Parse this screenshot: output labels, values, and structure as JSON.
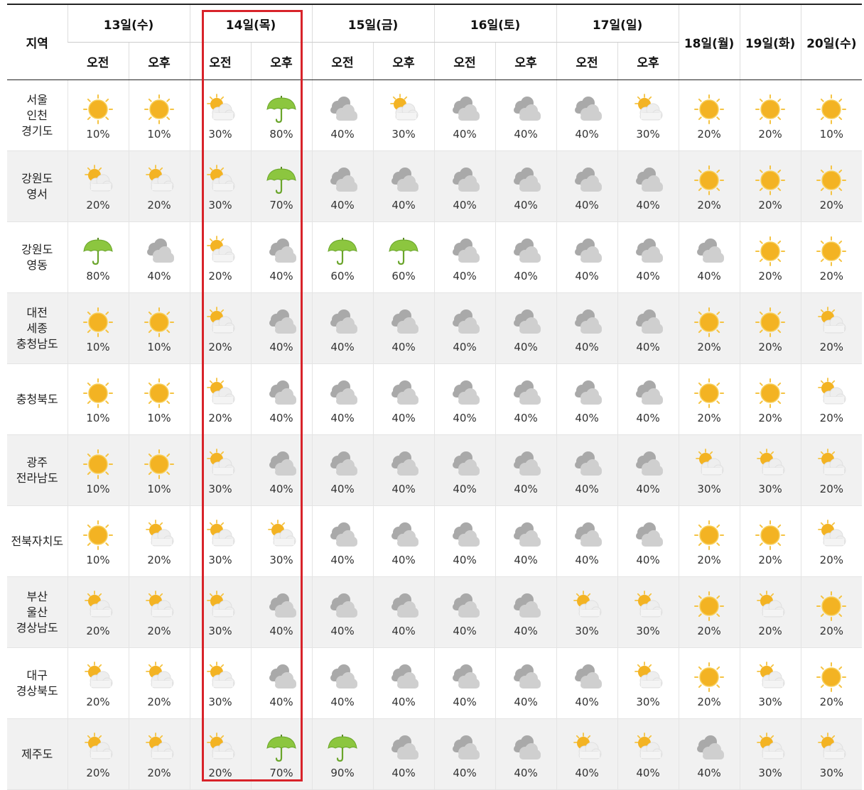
{
  "header": {
    "region_label": "지역",
    "days": [
      {
        "label": "13일(수)",
        "split": true
      },
      {
        "label": "14일(목)",
        "split": true
      },
      {
        "label": "15일(금)",
        "split": true
      },
      {
        "label": "16일(토)",
        "split": true
      },
      {
        "label": "17일(일)",
        "split": true
      },
      {
        "label": "18일(월)",
        "split": false
      },
      {
        "label": "19일(화)",
        "split": false
      },
      {
        "label": "20일(수)",
        "split": false
      }
    ],
    "am_label": "오전",
    "pm_label": "오후"
  },
  "highlight_color": "#d8232a",
  "icons": {
    "sun": "sun-icon",
    "partly": "partly-cloudy-icon",
    "cloud": "cloudy-icon",
    "rain": "umbrella-icon"
  },
  "rows": [
    {
      "region": "서울\n인천\n경기도",
      "cells": [
        {
          "icon": "sun",
          "pct": "10%"
        },
        {
          "icon": "sun",
          "pct": "10%"
        },
        {
          "icon": "partly",
          "pct": "30%"
        },
        {
          "icon": "rain",
          "pct": "80%"
        },
        {
          "icon": "cloud",
          "pct": "40%"
        },
        {
          "icon": "partly",
          "pct": "30%"
        },
        {
          "icon": "cloud",
          "pct": "40%"
        },
        {
          "icon": "cloud",
          "pct": "40%"
        },
        {
          "icon": "cloud",
          "pct": "40%"
        },
        {
          "icon": "partly",
          "pct": "30%"
        },
        {
          "icon": "sun",
          "pct": "20%"
        },
        {
          "icon": "sun",
          "pct": "20%"
        },
        {
          "icon": "sun",
          "pct": "10%"
        }
      ]
    },
    {
      "region": "강원도\n영서",
      "cells": [
        {
          "icon": "partly",
          "pct": "20%"
        },
        {
          "icon": "partly",
          "pct": "20%"
        },
        {
          "icon": "partly",
          "pct": "30%"
        },
        {
          "icon": "rain",
          "pct": "70%"
        },
        {
          "icon": "cloud",
          "pct": "40%"
        },
        {
          "icon": "cloud",
          "pct": "40%"
        },
        {
          "icon": "cloud",
          "pct": "40%"
        },
        {
          "icon": "cloud",
          "pct": "40%"
        },
        {
          "icon": "cloud",
          "pct": "40%"
        },
        {
          "icon": "cloud",
          "pct": "40%"
        },
        {
          "icon": "sun",
          "pct": "20%"
        },
        {
          "icon": "sun",
          "pct": "20%"
        },
        {
          "icon": "sun",
          "pct": "20%"
        }
      ]
    },
    {
      "region": "강원도\n영동",
      "cells": [
        {
          "icon": "rain",
          "pct": "80%"
        },
        {
          "icon": "cloud",
          "pct": "40%"
        },
        {
          "icon": "partly",
          "pct": "20%"
        },
        {
          "icon": "cloud",
          "pct": "40%"
        },
        {
          "icon": "rain",
          "pct": "60%"
        },
        {
          "icon": "rain",
          "pct": "60%"
        },
        {
          "icon": "cloud",
          "pct": "40%"
        },
        {
          "icon": "cloud",
          "pct": "40%"
        },
        {
          "icon": "cloud",
          "pct": "40%"
        },
        {
          "icon": "cloud",
          "pct": "40%"
        },
        {
          "icon": "cloud",
          "pct": "40%"
        },
        {
          "icon": "sun",
          "pct": "20%"
        },
        {
          "icon": "sun",
          "pct": "20%"
        }
      ]
    },
    {
      "region": "대전\n세종\n충청남도",
      "cells": [
        {
          "icon": "sun",
          "pct": "10%"
        },
        {
          "icon": "sun",
          "pct": "10%"
        },
        {
          "icon": "partly",
          "pct": "20%"
        },
        {
          "icon": "cloud",
          "pct": "40%"
        },
        {
          "icon": "cloud",
          "pct": "40%"
        },
        {
          "icon": "cloud",
          "pct": "40%"
        },
        {
          "icon": "cloud",
          "pct": "40%"
        },
        {
          "icon": "cloud",
          "pct": "40%"
        },
        {
          "icon": "cloud",
          "pct": "40%"
        },
        {
          "icon": "cloud",
          "pct": "40%"
        },
        {
          "icon": "sun",
          "pct": "20%"
        },
        {
          "icon": "sun",
          "pct": "20%"
        },
        {
          "icon": "partly",
          "pct": "20%"
        }
      ]
    },
    {
      "region": "충청북도",
      "cells": [
        {
          "icon": "sun",
          "pct": "10%"
        },
        {
          "icon": "sun",
          "pct": "10%"
        },
        {
          "icon": "partly",
          "pct": "20%"
        },
        {
          "icon": "cloud",
          "pct": "40%"
        },
        {
          "icon": "cloud",
          "pct": "40%"
        },
        {
          "icon": "cloud",
          "pct": "40%"
        },
        {
          "icon": "cloud",
          "pct": "40%"
        },
        {
          "icon": "cloud",
          "pct": "40%"
        },
        {
          "icon": "cloud",
          "pct": "40%"
        },
        {
          "icon": "cloud",
          "pct": "40%"
        },
        {
          "icon": "sun",
          "pct": "20%"
        },
        {
          "icon": "sun",
          "pct": "20%"
        },
        {
          "icon": "partly",
          "pct": "20%"
        }
      ]
    },
    {
      "region": "광주\n전라남도",
      "cells": [
        {
          "icon": "sun",
          "pct": "10%"
        },
        {
          "icon": "sun",
          "pct": "10%"
        },
        {
          "icon": "partly",
          "pct": "30%"
        },
        {
          "icon": "cloud",
          "pct": "40%"
        },
        {
          "icon": "cloud",
          "pct": "40%"
        },
        {
          "icon": "cloud",
          "pct": "40%"
        },
        {
          "icon": "cloud",
          "pct": "40%"
        },
        {
          "icon": "cloud",
          "pct": "40%"
        },
        {
          "icon": "cloud",
          "pct": "40%"
        },
        {
          "icon": "cloud",
          "pct": "40%"
        },
        {
          "icon": "partly",
          "pct": "30%"
        },
        {
          "icon": "partly",
          "pct": "30%"
        },
        {
          "icon": "partly",
          "pct": "20%"
        }
      ]
    },
    {
      "region": "전북자치도",
      "cells": [
        {
          "icon": "sun",
          "pct": "10%"
        },
        {
          "icon": "partly",
          "pct": "20%"
        },
        {
          "icon": "partly",
          "pct": "30%"
        },
        {
          "icon": "partly",
          "pct": "30%"
        },
        {
          "icon": "cloud",
          "pct": "40%"
        },
        {
          "icon": "cloud",
          "pct": "40%"
        },
        {
          "icon": "cloud",
          "pct": "40%"
        },
        {
          "icon": "cloud",
          "pct": "40%"
        },
        {
          "icon": "cloud",
          "pct": "40%"
        },
        {
          "icon": "cloud",
          "pct": "40%"
        },
        {
          "icon": "sun",
          "pct": "20%"
        },
        {
          "icon": "sun",
          "pct": "20%"
        },
        {
          "icon": "partly",
          "pct": "20%"
        }
      ]
    },
    {
      "region": "부산\n울산\n경상남도",
      "cells": [
        {
          "icon": "partly",
          "pct": "20%"
        },
        {
          "icon": "partly",
          "pct": "20%"
        },
        {
          "icon": "partly",
          "pct": "30%"
        },
        {
          "icon": "cloud",
          "pct": "40%"
        },
        {
          "icon": "cloud",
          "pct": "40%"
        },
        {
          "icon": "cloud",
          "pct": "40%"
        },
        {
          "icon": "cloud",
          "pct": "40%"
        },
        {
          "icon": "cloud",
          "pct": "40%"
        },
        {
          "icon": "partly",
          "pct": "30%"
        },
        {
          "icon": "partly",
          "pct": "30%"
        },
        {
          "icon": "sun",
          "pct": "20%"
        },
        {
          "icon": "partly",
          "pct": "20%"
        },
        {
          "icon": "sun",
          "pct": "20%"
        }
      ]
    },
    {
      "region": "대구\n경상북도",
      "cells": [
        {
          "icon": "partly",
          "pct": "20%"
        },
        {
          "icon": "partly",
          "pct": "20%"
        },
        {
          "icon": "partly",
          "pct": "30%"
        },
        {
          "icon": "cloud",
          "pct": "40%"
        },
        {
          "icon": "cloud",
          "pct": "40%"
        },
        {
          "icon": "cloud",
          "pct": "40%"
        },
        {
          "icon": "cloud",
          "pct": "40%"
        },
        {
          "icon": "cloud",
          "pct": "40%"
        },
        {
          "icon": "cloud",
          "pct": "40%"
        },
        {
          "icon": "partly",
          "pct": "30%"
        },
        {
          "icon": "sun",
          "pct": "20%"
        },
        {
          "icon": "partly",
          "pct": "30%"
        },
        {
          "icon": "sun",
          "pct": "20%"
        }
      ]
    },
    {
      "region": "제주도",
      "cells": [
        {
          "icon": "partly",
          "pct": "20%"
        },
        {
          "icon": "partly",
          "pct": "20%"
        },
        {
          "icon": "partly",
          "pct": "20%"
        },
        {
          "icon": "rain",
          "pct": "70%"
        },
        {
          "icon": "rain",
          "pct": "90%"
        },
        {
          "icon": "cloud",
          "pct": "40%"
        },
        {
          "icon": "cloud",
          "pct": "40%"
        },
        {
          "icon": "cloud",
          "pct": "40%"
        },
        {
          "icon": "partly",
          "pct": "40%"
        },
        {
          "icon": "partly",
          "pct": "40%"
        },
        {
          "icon": "cloud",
          "pct": "40%"
        },
        {
          "icon": "partly",
          "pct": "30%"
        },
        {
          "icon": "partly",
          "pct": "30%"
        }
      ]
    }
  ]
}
